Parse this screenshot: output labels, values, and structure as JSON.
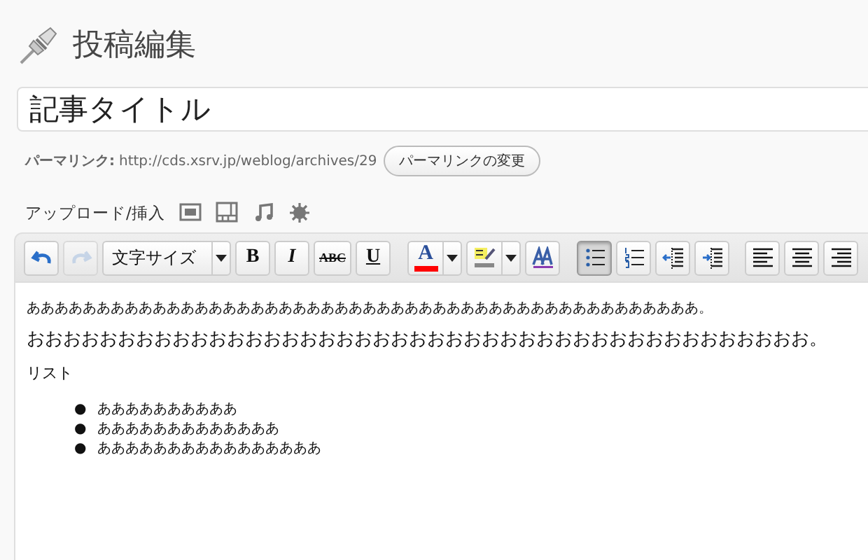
{
  "page": {
    "title": "投稿編集"
  },
  "post_title": {
    "value": "記事タイトル"
  },
  "permalink": {
    "label": "パーマリンク:",
    "url": "http://cds.xsrv.jp/weblog/archives/29",
    "button": "パーマリンクの変更"
  },
  "upload": {
    "label": "アップロード/挿入",
    "icons": [
      {
        "kind": "image"
      },
      {
        "kind": "video"
      },
      {
        "kind": "audio"
      },
      {
        "kind": "media"
      }
    ]
  },
  "toolbar": {
    "buttons": [
      {
        "kind": "undo",
        "selected": false,
        "disabled": false
      },
      {
        "kind": "redo",
        "selected": false,
        "disabled": true
      },
      {
        "kind": "select",
        "value": "文字サイズ",
        "selected": false,
        "disabled": false
      },
      {
        "kind": "bold",
        "label": "B",
        "selected": false,
        "disabled": false
      },
      {
        "kind": "italic",
        "label": "I",
        "selected": false,
        "disabled": false
      },
      {
        "kind": "strike",
        "label": "ABC",
        "selected": false,
        "disabled": false
      },
      {
        "kind": "underline",
        "label": "U",
        "selected": false,
        "disabled": false
      },
      {
        "kind": "forecolor",
        "label": "A",
        "color": "#ff0000",
        "selected": false,
        "disabled": false
      },
      {
        "kind": "highlight",
        "selected": false,
        "disabled": false
      },
      {
        "kind": "style",
        "selected": false,
        "disabled": false
      },
      {
        "kind": "bullets",
        "selected": true,
        "disabled": false
      },
      {
        "kind": "numbers",
        "selected": false,
        "disabled": false
      },
      {
        "kind": "outdent",
        "selected": false,
        "disabled": false
      },
      {
        "kind": "indent",
        "selected": false,
        "disabled": false
      },
      {
        "kind": "align-left",
        "selected": false,
        "disabled": false
      },
      {
        "kind": "align-center",
        "selected": false,
        "disabled": false
      },
      {
        "kind": "align-right",
        "selected": false,
        "disabled": false
      }
    ]
  },
  "content": [
    {
      "kind": "paragraph",
      "text": "ああああああああああああああああああああああああああああああああああああああああああああああああ。"
    },
    {
      "kind": "large-paragraph",
      "text": "おおおおおおおおおおおおおおおおおおおおおおおおおおおおおおおおおおおおおおおおおおお。"
    },
    {
      "kind": "small-paragraph",
      "text": "リスト"
    },
    {
      "kind": "list",
      "bullet": "●",
      "items": [
        "ああああああああああ",
        "あああああああああああああ",
        "ああああああああああああああああ"
      ]
    }
  ]
}
